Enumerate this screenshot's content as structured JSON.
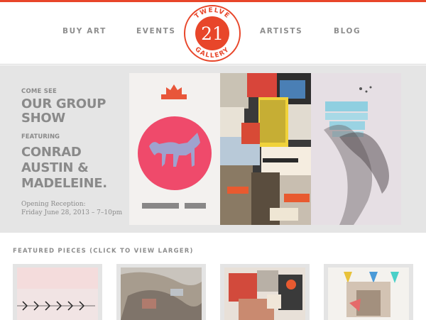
{
  "nav": {
    "buy_art": "BUY ART",
    "events": "EVENTS",
    "artists": "ARTISTS",
    "blog": "BLOG"
  },
  "logo": {
    "top_text": "TWELVE",
    "number": "21",
    "bottom_text": "GALLERY"
  },
  "hero": {
    "come_see": "COME SEE",
    "title_line1": "OUR GROUP",
    "title_line2": "SHOW",
    "featuring": "FEATURING",
    "artists_line1": "CONRAD",
    "artists_line2": "AUSTIN &",
    "artists_line3": "MADELEINE.",
    "opening_line1": "Opening Reception:",
    "opening_line2": "Friday June 28, 2013 – 7–10pm"
  },
  "featured": {
    "heading": "FEATURED PIECES (CLICK TO VIEW LARGER)"
  },
  "colors": {
    "accent": "#e8462a",
    "text_gray": "#8a8a8a",
    "hero_bg": "#e5e5e5"
  }
}
